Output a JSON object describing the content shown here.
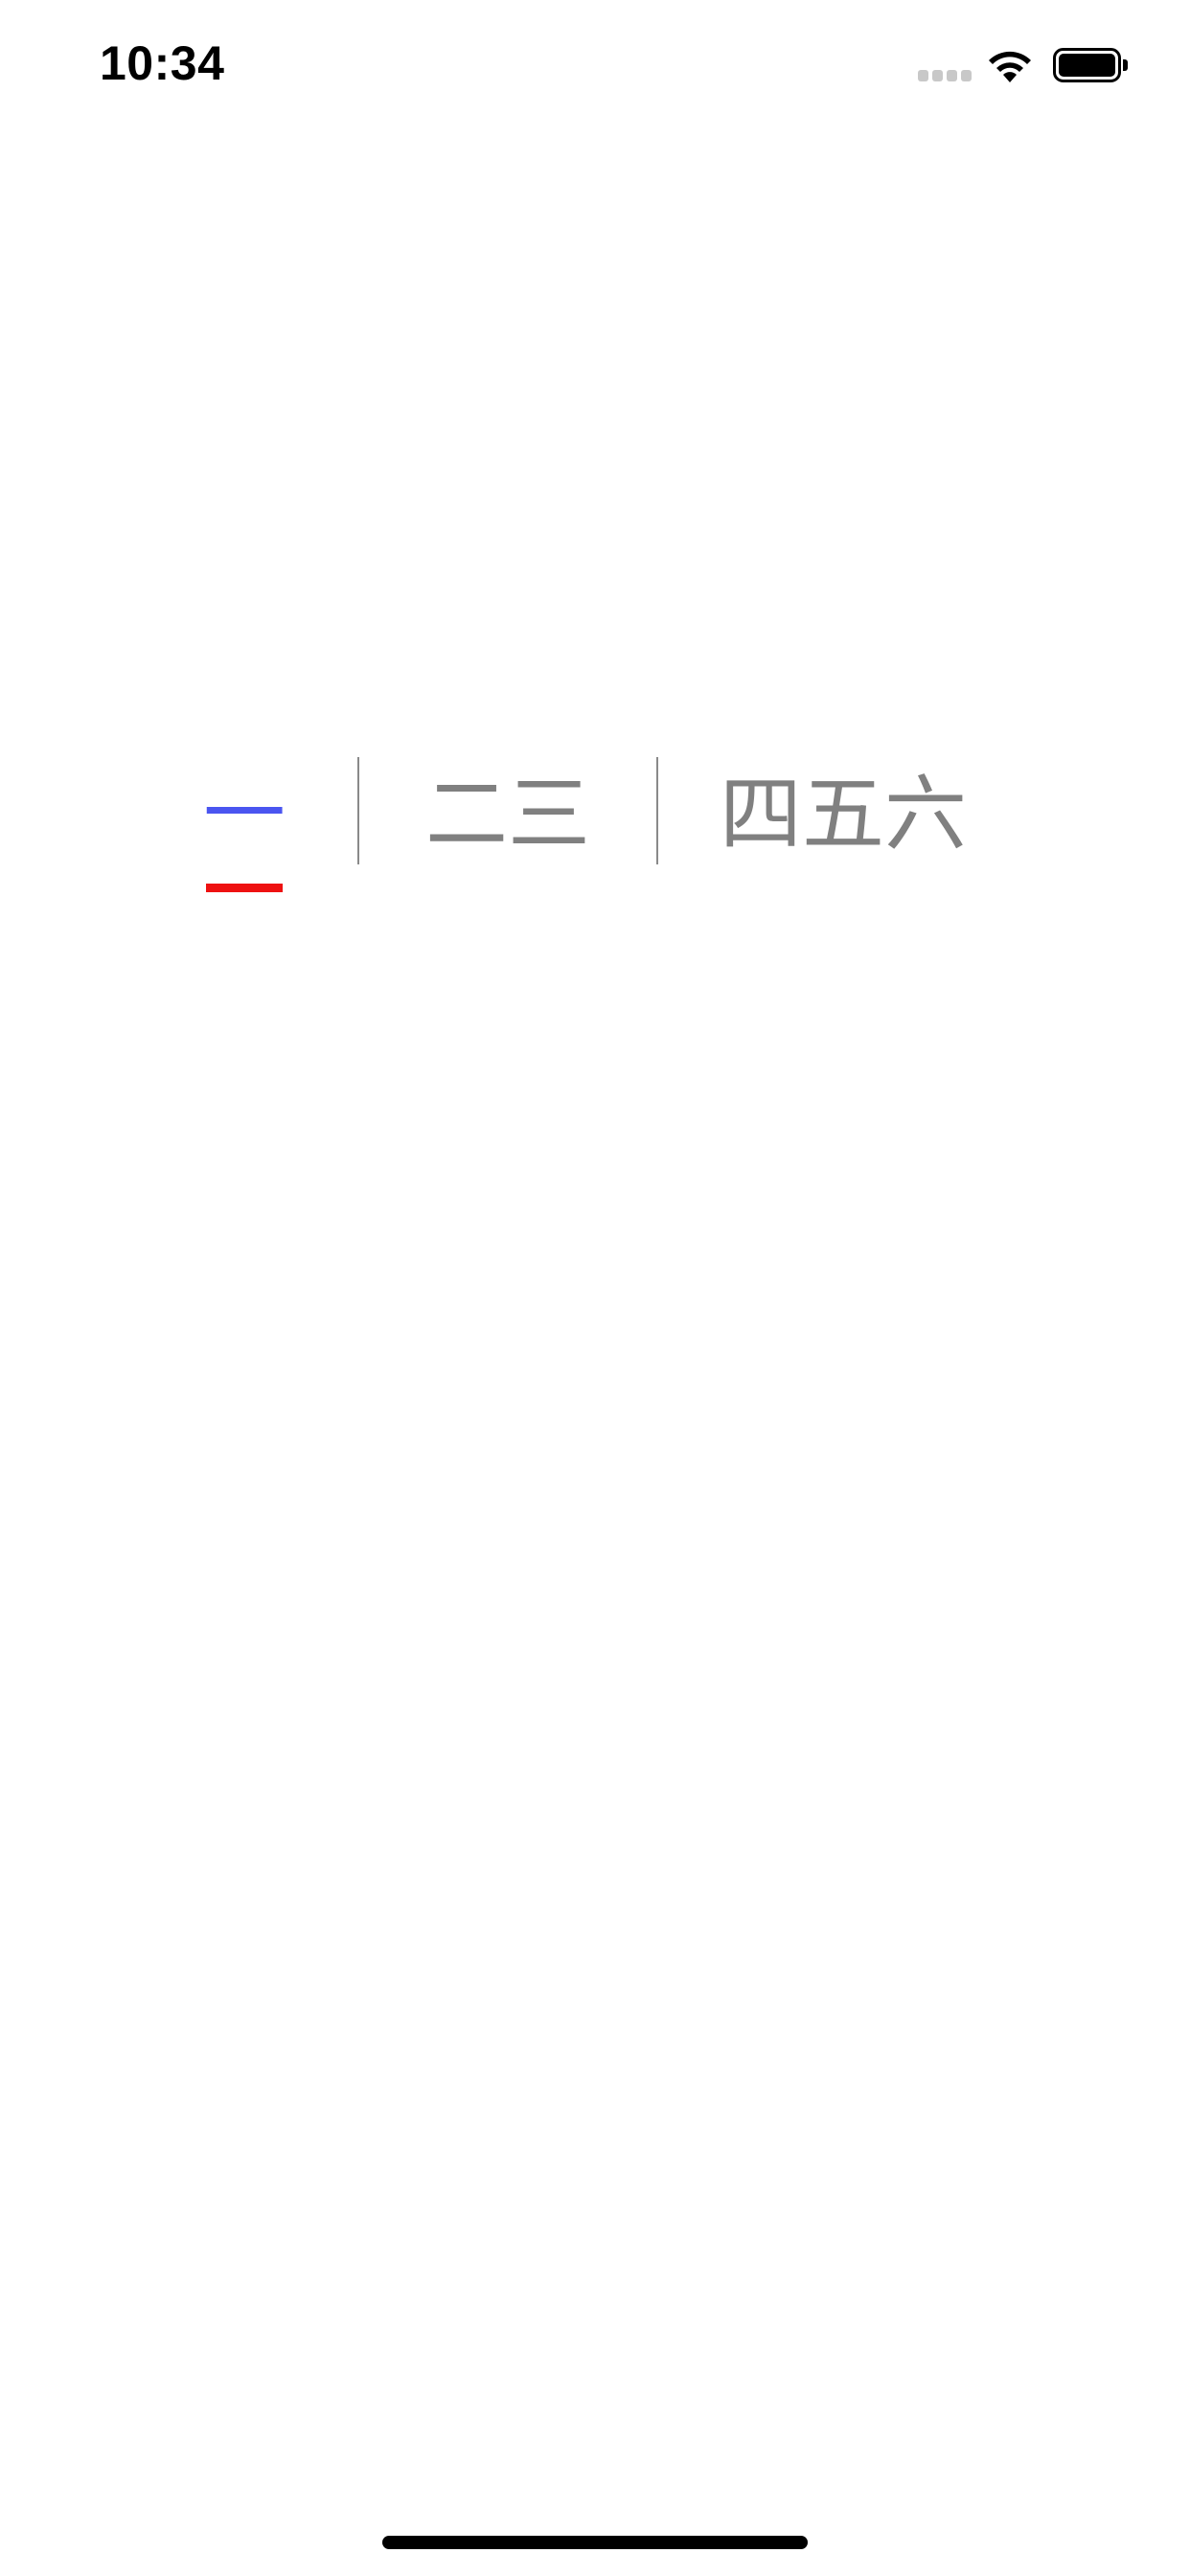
{
  "status_bar": {
    "time": "10:34",
    "icons": {
      "signal": "cellular-signal-icon",
      "wifi": "wifi-icon",
      "battery": "battery-icon"
    }
  },
  "tabs": [
    {
      "label": "一",
      "selected": true
    },
    {
      "label": "二三",
      "selected": false
    },
    {
      "label": "四五六",
      "selected": false
    }
  ],
  "colors": {
    "selected_text": "#4a55f0",
    "unselected_text": "#808080",
    "indicator": "#ee1111",
    "divider": "#8a8a8a",
    "background": "#ffffff"
  }
}
